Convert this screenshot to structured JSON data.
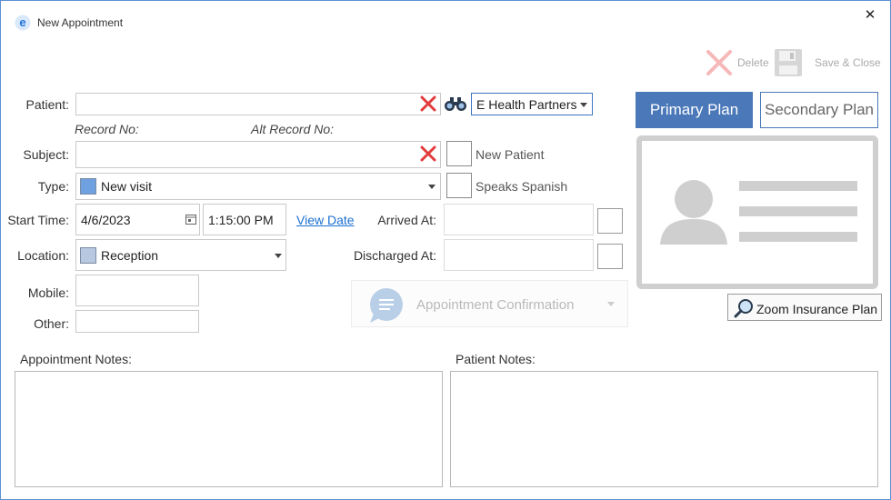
{
  "window": {
    "title": "New Appointment",
    "app_icon": "e-logo-icon",
    "close_glyph": "✕"
  },
  "toolbar": {
    "delete_label": "Delete",
    "save_close_label": "Save & Close"
  },
  "form": {
    "patient_label": "Patient:",
    "patient_value": "",
    "record_no_label": "Record No:",
    "alt_record_no_label": "Alt Record No:",
    "subject_label": "Subject:",
    "subject_value": "",
    "type_label": "Type:",
    "type_value": "New visit",
    "type_color": "#6fa0e0",
    "start_time_label": "Start Time:",
    "start_date": "4/6/2023",
    "start_time": "1:15:00 PM",
    "view_date_link": "View Date",
    "location_label": "Location:",
    "location_value": "Reception",
    "location_color": "#b8c8e0",
    "mobile_label": "Mobile:",
    "mobile_value": "",
    "other_label": "Other:",
    "other_value": "",
    "arrived_label": "Arrived At:",
    "arrived_value": "",
    "discharged_label": "Discharged At:",
    "discharged_value": "",
    "practice_value": "E Health Partners",
    "new_patient_label": "New Patient",
    "speaks_spanish_label": "Speaks Spanish",
    "appointment_confirmation_label": "Appointment Confirmation"
  },
  "insurance": {
    "primary_tab": "Primary Plan",
    "secondary_tab": "Secondary Plan",
    "zoom_button": "Zoom Insurance Plan",
    "accent_color": "#4a78b8"
  },
  "notes": {
    "appointment_notes_label": "Appointment Notes:",
    "appointment_notes_value": "",
    "patient_notes_label": "Patient Notes:",
    "patient_notes_value": ""
  }
}
